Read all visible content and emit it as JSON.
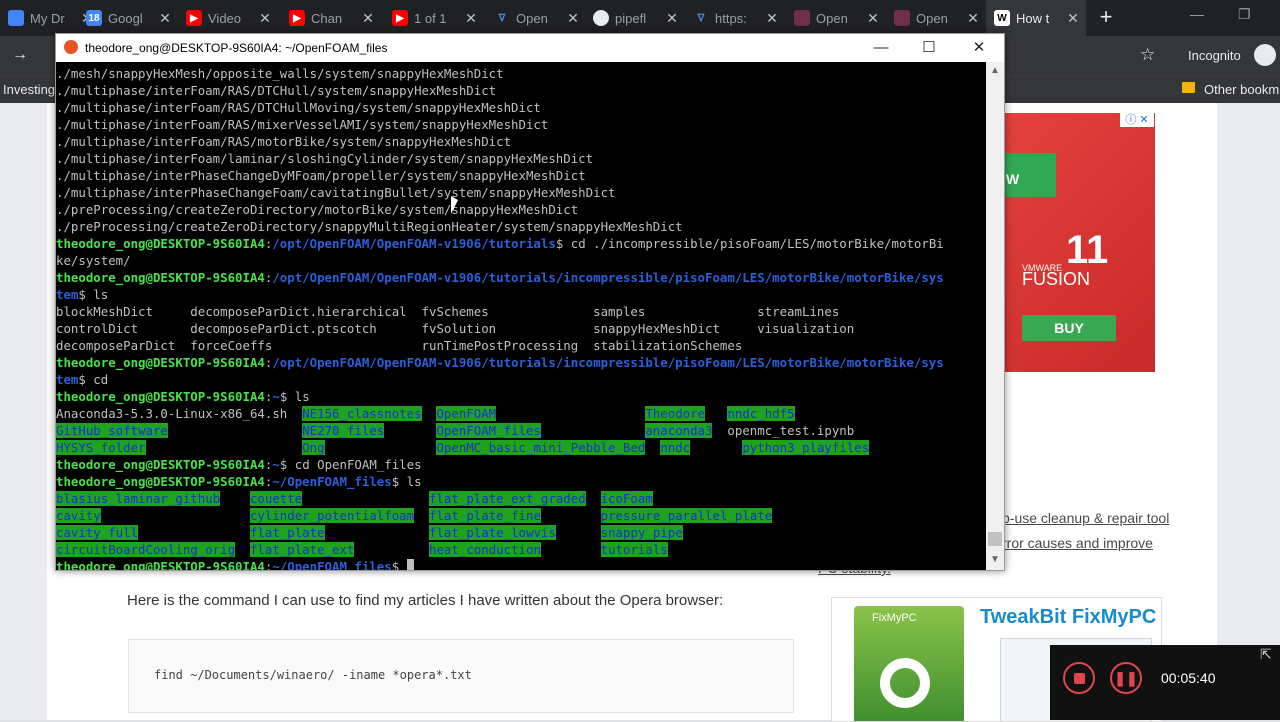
{
  "tabs": [
    {
      "title": "My Dr",
      "icon": "drive-icon"
    },
    {
      "title": "Googl",
      "icon": "calendar-icon",
      "badge": "18"
    },
    {
      "title": "Video",
      "icon": "youtube-icon"
    },
    {
      "title": "Chan",
      "icon": "youtube-icon"
    },
    {
      "title": "1 of 1",
      "icon": "youtube-icon"
    },
    {
      "title": "Open",
      "icon": "openfoam-icon"
    },
    {
      "title": "pipefl",
      "icon": "github-icon"
    },
    {
      "title": "https:",
      "icon": "openfoam-icon"
    },
    {
      "title": "Open",
      "icon": "grid-icon"
    },
    {
      "title": "Open",
      "icon": "grid-icon"
    },
    {
      "title": "How t",
      "icon": "winaero-icon",
      "badge": "W"
    }
  ],
  "browser": {
    "incognito_label": "Incognito",
    "bookmark_left": "Investing",
    "bookmark_other": "Other bookm"
  },
  "terminal": {
    "title": "theodore_ong@DESKTOP-9S60IA4: ~/OpenFOAM_files"
  },
  "page": {
    "article_text": "Here is the command I can use to find my articles I have written about the Opera browser:",
    "code": "find ~/Documents/winaero/ -iname *opera*.txt",
    "side_line1": "p-use cleanup & repair tool",
    "side_line2": "rror causes and improve",
    "side_line3": "PC stability."
  },
  "ads": {
    "vmware": {
      "version": "11",
      "brand": "VMWARE",
      "product": "FUSION",
      "cta": "BUY",
      "tag": "W"
    },
    "tweakbit": {
      "title": "TweakBit FixMyPC",
      "box_label": "FixMyPC"
    }
  },
  "recorder": {
    "time": "00:05:40"
  },
  "colors": {
    "prompt_user": "#4ae24a",
    "prompt_path": "#2c5fd9",
    "dir_highlight": "#1da31d"
  }
}
